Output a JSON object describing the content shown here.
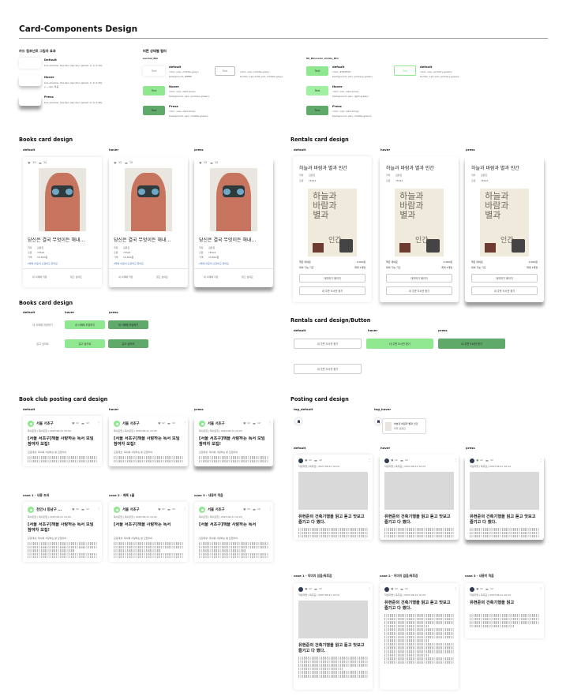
{
  "title": "Card-Components Design",
  "shadow": {
    "heading": "카드 컴포넌트 그림자 효과",
    "default": {
      "label": "Default",
      "desc": "box-shadow: 0px 0px 4px 0px rgba(0, 0, 0, 0.10);"
    },
    "hover": {
      "label": "Hover",
      "desc": "box-shadow: 0px 6px 4px 0px rgba(0, 0, 0, 0.25);",
      "desc2": "y: ~4px 적용"
    },
    "press": {
      "label": "Press",
      "desc": "box-shadow: 0px 6px 4px 0px rgba(0, 0, 0, 0.40);"
    }
  },
  "button_states": {
    "heading": "버튼 상태별 컬러",
    "normal": {
      "name": "normal_Btn",
      "sample": "Text",
      "default": {
        "label": "default",
        "l1": "color: var(--middle-gray);",
        "l2": "background: #ffffff;"
      },
      "default2": {
        "l1": "color: var(--middle-gray);",
        "l2": "border: 1px solid var(--middle-gray);"
      },
      "hover": {
        "label": "Hover",
        "l1": "color: var(--dark-blue);",
        "l2": "background: var(--primary-green);"
      },
      "press": {
        "label": "Press",
        "l1": "color: var(--dark-blue);",
        "l2": "background: var(--middle-green);"
      }
    },
    "fill": {
      "name": "fill_Btn/color_stroke_Btn",
      "sample": "Text",
      "default": {
        "label": "default",
        "l1": "color: #50783C;",
        "l2": "background: var(--primary-green);"
      },
      "default2": {
        "label": "default",
        "l1": "color: var(--primary-green);",
        "l2": "border: 1px var(--primary-green);"
      },
      "hover": {
        "label": "Hover",
        "l1": "color: var(--dark-blue);",
        "l2": "background: var(--light-green);"
      },
      "press": {
        "label": "Press",
        "l1": "color: var(--dark-blue);",
        "l2": "background: var(--middle-green);"
      }
    }
  },
  "colors": {
    "primary_green": "#8fe88f",
    "middle_green": "#5faa6a",
    "light_gray": "#d9d9d9"
  },
  "books": {
    "heading": "Books card design",
    "states": [
      "default",
      "hover",
      "press"
    ],
    "likes": "12",
    "comments": "12",
    "title": "당신은 결국 무엇이든 해내…",
    "author_k": "저자",
    "author": "김유진",
    "pub_k": "출판",
    "pub": "YES24",
    "price_k": "가격",
    "price": "16,800원",
    "link": "2명의 이웃이 소장하고 있어요",
    "btn1": "내 서재에 저장",
    "btn2": "읽고 싶어요"
  },
  "books_buttons": {
    "heading": "Books card design",
    "cols": [
      "default",
      "hover",
      "press"
    ],
    "row1": "내 서재에 저장하기",
    "row2": "읽고 싶어요"
  },
  "rentals": {
    "heading": "Rentals card design",
    "states": [
      "default",
      "hover",
      "press"
    ],
    "title": "하늘과 바람과 별과 인간",
    "author_k": "저자",
    "author": "김유진",
    "pub_k": "출판",
    "pub": "YES24",
    "cover_text": "하늘과\n바람과\n별과",
    "cover_sub": "인간",
    "price_k": "책값 대여료",
    "price": "2,000원",
    "period_k": "대여 가능 기간",
    "period": "최대 2개월",
    "btn1": "대여하기 페이지",
    "btn2": "내 주변 도서관 찾기"
  },
  "rentals_buttons": {
    "heading": "Rentals card design/Button",
    "cols": [
      "default",
      "hover",
      "press"
    ],
    "btn": "내 주변 도서관 찾기",
    "btn2": "내 주변 도서관 찾기"
  },
  "bookclub": {
    "heading": "Book club posting card design",
    "states": [
      "default",
      "hover",
      "press"
    ],
    "name": "서울 서초구",
    "likes": "12",
    "comments": "12",
    "meta": "독서모임 | 독서모임 | 2023.06.21 10:24",
    "title": "[서울 서초구]책을 사랑하는 독서 모임 참여자 모집!",
    "sub": "모집대상: 독서를 사랑하는 분 모임이야",
    "cases": [
      {
        "label": "case 1 - 내용 초과",
        "name": "천안시 동남구 ..."
      },
      {
        "label": "case 2 - 제목 1줄",
        "name": "서울 서초구",
        "title": "[서울 서초구]책을 사랑하는 독서"
      },
      {
        "label": "case 3 - 내용이 적음",
        "name": "서울 서초구",
        "title": "[서울 서초구]책을 사랑하는 독서"
      }
    ]
  },
  "posting": {
    "heading": "Posting card design",
    "tag_default": "tag_default",
    "tag_hover": "tag_hover",
    "tag_title": "하늘과 바람과 별과 인간",
    "tag_author": "저자 김유진",
    "states": [
      "default",
      "hover",
      "press"
    ],
    "likes": "12",
    "comments": "12",
    "meta": "작성자명 | 독후감 | 2023.06.21 10:24",
    "title": "유현준의 건축기행을 읽고 듣고 맛보고 즐기고 다 했다.",
    "cases": [
      {
        "label": "case 1 - 이미지 있음/독후감"
      },
      {
        "label": "case 2 - 이미지 없음/독후감"
      },
      {
        "label": "case 3 - 내용이 적음",
        "title": "유현준의 건축기행을 읽고"
      }
    ]
  }
}
